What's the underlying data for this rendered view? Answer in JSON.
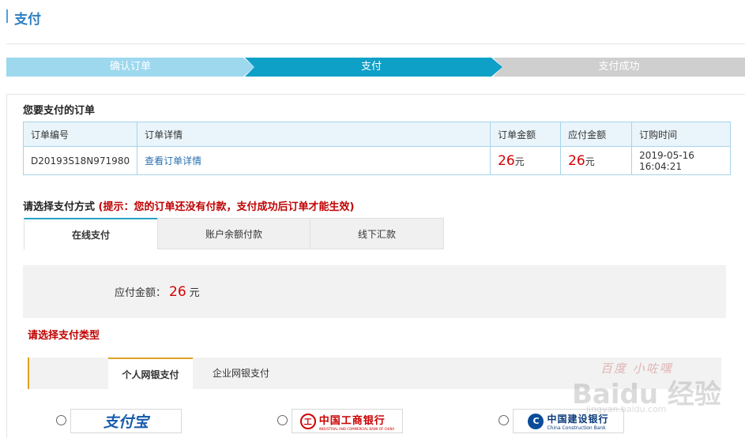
{
  "page": {
    "title": "支付"
  },
  "steps": [
    {
      "label": "确认订单",
      "state": "done"
    },
    {
      "label": "支付",
      "state": "current"
    },
    {
      "label": "支付成功",
      "state": "pending"
    }
  ],
  "order_section": {
    "title": "您要支付的订单",
    "headers": [
      "订单编号",
      "订单详情",
      "订单金额",
      "应付金额",
      "订购时间"
    ],
    "row": {
      "order_no": "D20193S18N971980",
      "detail_link": "查看订单详情",
      "order_amount": "26",
      "due_amount": "26",
      "unit": "元",
      "time": "2019-05-16 16:04:21"
    }
  },
  "payment_method": {
    "title": "请选择支付方式",
    "hint": "(提示：您的订单还没有付款，支付成功后订单才能生效)",
    "tabs": [
      "在线支付",
      "账户余额付款",
      "线下汇款"
    ],
    "active_tab": 0
  },
  "due": {
    "label": "应付金额：",
    "amount": "26",
    "unit": "元"
  },
  "payment_type": {
    "title": "请选择支付类型",
    "tabs": [
      "个人网银支付",
      "企业网银支付"
    ],
    "active_tab": 0
  },
  "banks": [
    {
      "name": "支付宝",
      "icon": "alipay-logo"
    },
    {
      "name": "中国工商银行",
      "en": "INDUSTRIAL AND COMMERCIAL BANK OF CHINA",
      "icon": "icbc-logo"
    },
    {
      "name": "中国建设银行",
      "en": "China Construction Bank",
      "icon": "ccb-logo"
    }
  ],
  "watermark": {
    "line1": "百度 小咗嘿",
    "line2": "Baidu 经验",
    "line3": "jingyan.baidu.com"
  },
  "colors": {
    "accent": "#0fa0c7",
    "money": "#d40000",
    "hint": "#c00000",
    "title": "#2d7fc1"
  }
}
